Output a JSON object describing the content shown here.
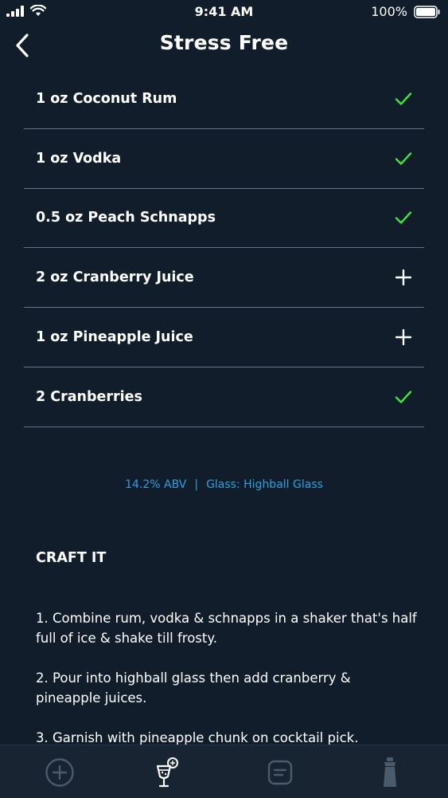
{
  "status_bar": {
    "time": "9:41 AM",
    "battery_percent": "100%"
  },
  "nav": {
    "title": "Stress Free"
  },
  "ingredients": [
    {
      "label": "1 oz Coconut Rum",
      "state": "check"
    },
    {
      "label": "1 oz Vodka",
      "state": "check"
    },
    {
      "label": "0.5 oz Peach Schnapps",
      "state": "check"
    },
    {
      "label": "2 oz Cranberry Juice",
      "state": "add"
    },
    {
      "label": "1 oz Pineapple Juice",
      "state": "add"
    },
    {
      "label": "2 Cranberries",
      "state": "check"
    }
  ],
  "info": {
    "abv": "14.2% ABV",
    "separator": "|",
    "glass": "Glass: Highball Glass"
  },
  "craft": {
    "heading": "CRAFT IT",
    "steps": [
      "1. Combine rum, vodka & schnapps in a shaker that's half full of ice & shake till frosty.",
      "2. Pour into highball glass then add cranberry & pineapple juices.",
      "3. Garnish with pineapple chunk on cocktail pick."
    ]
  },
  "tabs": [
    {
      "icon": "add-circle-icon",
      "active": false
    },
    {
      "icon": "cocktail-glass-icon",
      "active": true
    },
    {
      "icon": "notes-icon",
      "active": false
    },
    {
      "icon": "shaker-icon",
      "active": false
    }
  ],
  "colors": {
    "background": "#111d2b",
    "check": "#3ee83a",
    "accent_blue": "#2f9fe0",
    "divider": "#5f7286",
    "tab_inactive": "#4a5b6e"
  }
}
